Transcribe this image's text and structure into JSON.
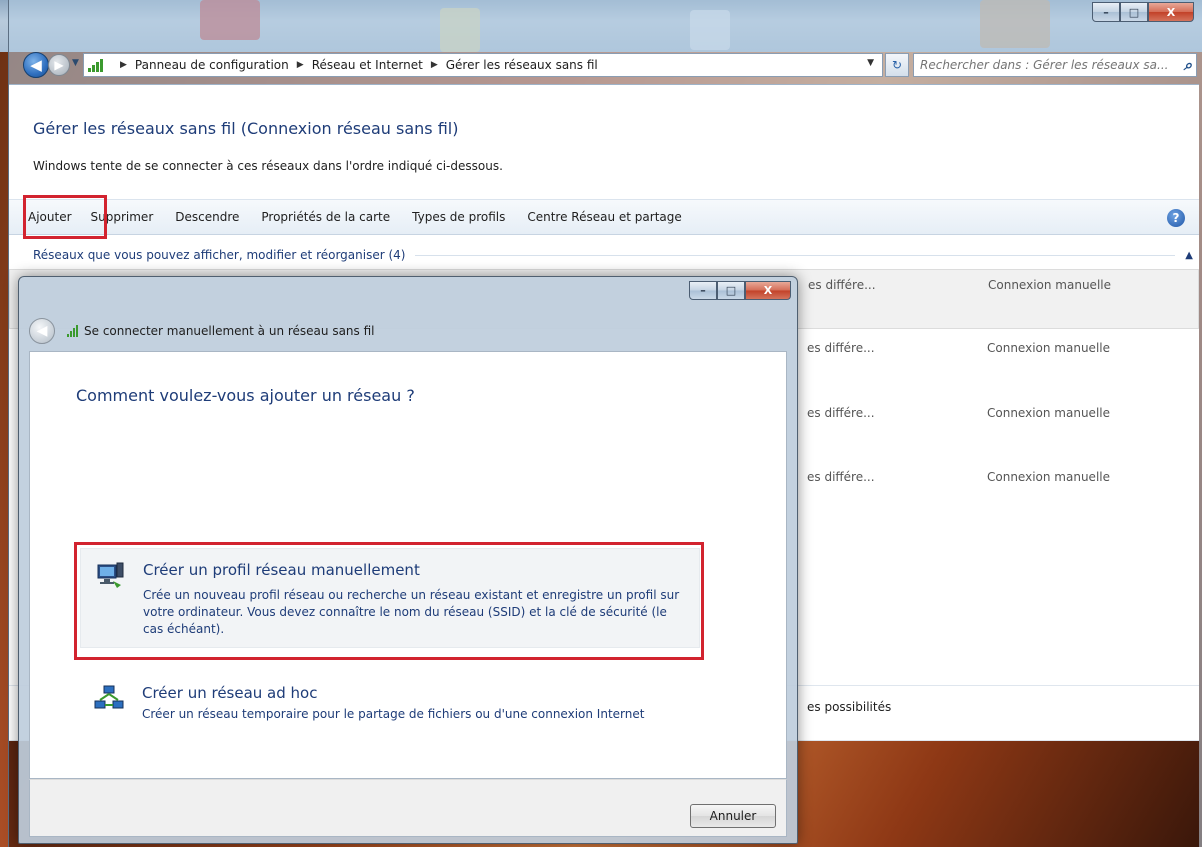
{
  "window": {
    "caption": {
      "minimize": "–",
      "maximize": "□",
      "close": "X"
    }
  },
  "address_bar": {
    "crumbs": [
      "Panneau de configuration",
      "Réseau et Internet",
      "Gérer les réseaux sans fil"
    ],
    "search_placeholder": "Rechercher dans : Gérer les réseaux sa..."
  },
  "page": {
    "title": "Gérer les réseaux sans fil (Connexion réseau sans fil)",
    "subtitle": "Windows tente de se connecter à ces réseaux dans l'ordre indiqué ci-dessous."
  },
  "toolbar": {
    "items": [
      "Ajouter",
      "Supprimer",
      "Descendre",
      "Propriétés de la carte",
      "Types de profils",
      "Centre Réseau et partage"
    ],
    "help": "?"
  },
  "group": {
    "header": "Réseaux que vous pouvez afficher, modifier et réorganiser (4)",
    "rows": [
      {
        "col_a": "es différe...",
        "col_b": "Connexion manuelle"
      },
      {
        "col_a": "es différe...",
        "col_b": "Connexion manuelle"
      },
      {
        "col_a": "es différe...",
        "col_b": "Connexion manuelle"
      },
      {
        "col_a": "es différe...",
        "col_b": "Connexion manuelle"
      }
    ],
    "footer_text": "es possibilités"
  },
  "dialog": {
    "nav_title": "Se connecter manuellement à un réseau sans fil",
    "question": "Comment voulez-vous ajouter un réseau ?",
    "options": [
      {
        "title": "Créer un profil réseau manuellement",
        "desc": "Crée un nouveau profil réseau ou recherche un réseau existant et enregistre un profil sur votre ordinateur. Vous devez connaître le nom du réseau (SSID) et la clé de sécurité (le cas échéant)."
      },
      {
        "title": "Créer un réseau ad hoc",
        "desc": "Créer un réseau temporaire pour le partage de fichiers ou d'une connexion Internet"
      }
    ],
    "cancel_label": "Annuler"
  },
  "colors": {
    "accent_text": "#1e3c78",
    "highlight_red": "#d2232f",
    "wifi_green": "#3b9a2e"
  }
}
